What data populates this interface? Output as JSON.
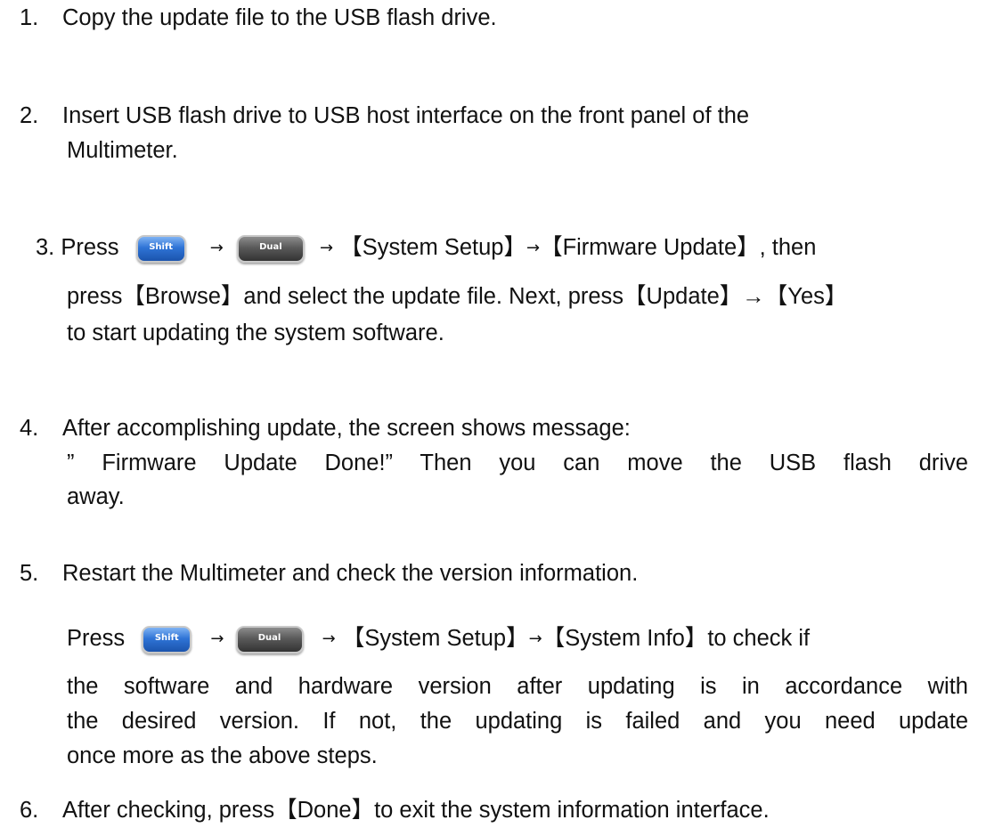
{
  "steps": [
    {
      "num": "1.",
      "lines": [
        "Copy the update file to the USB flash drive."
      ]
    },
    {
      "num": "2.",
      "lines": [
        "Insert USB flash drive to USB host interface on the front panel of the",
        "Multimeter."
      ]
    },
    {
      "num": "3.",
      "press": "Press",
      "arrow": "→",
      "menu1": "【System Setup】",
      "menu2": "【Firmware Update】",
      "tail": ", then",
      "lines": [
        "press【Browse】and select the update file. Next, press【Update】→【Yes】",
        "to start updating the system software."
      ]
    },
    {
      "num": "4.",
      "lines": [
        "After accomplishing update, the screen shows message:",
        "” Firmware Update Done!” Then you can move the USB flash drive",
        "away."
      ]
    },
    {
      "num": "5.",
      "lines": [
        "Restart the Multimeter and check the version information."
      ],
      "press": "Press",
      "arrow": "→",
      "menu1": "【System Setup】",
      "menu2": "【System Info】",
      "tail": "to check if",
      "more": [
        "the software and hardware version after updating is in accordance with",
        "the desired version. If not, the updating is failed and you need update",
        "once more as the above steps."
      ]
    },
    {
      "num": "6.",
      "lines": [
        "After checking, press【Done】to exit the system information interface."
      ]
    }
  ],
  "keys": {
    "shift": "Shift",
    "dual": "Dual",
    "shift_color": "#2f74d6",
    "dual_color": "#555555"
  }
}
